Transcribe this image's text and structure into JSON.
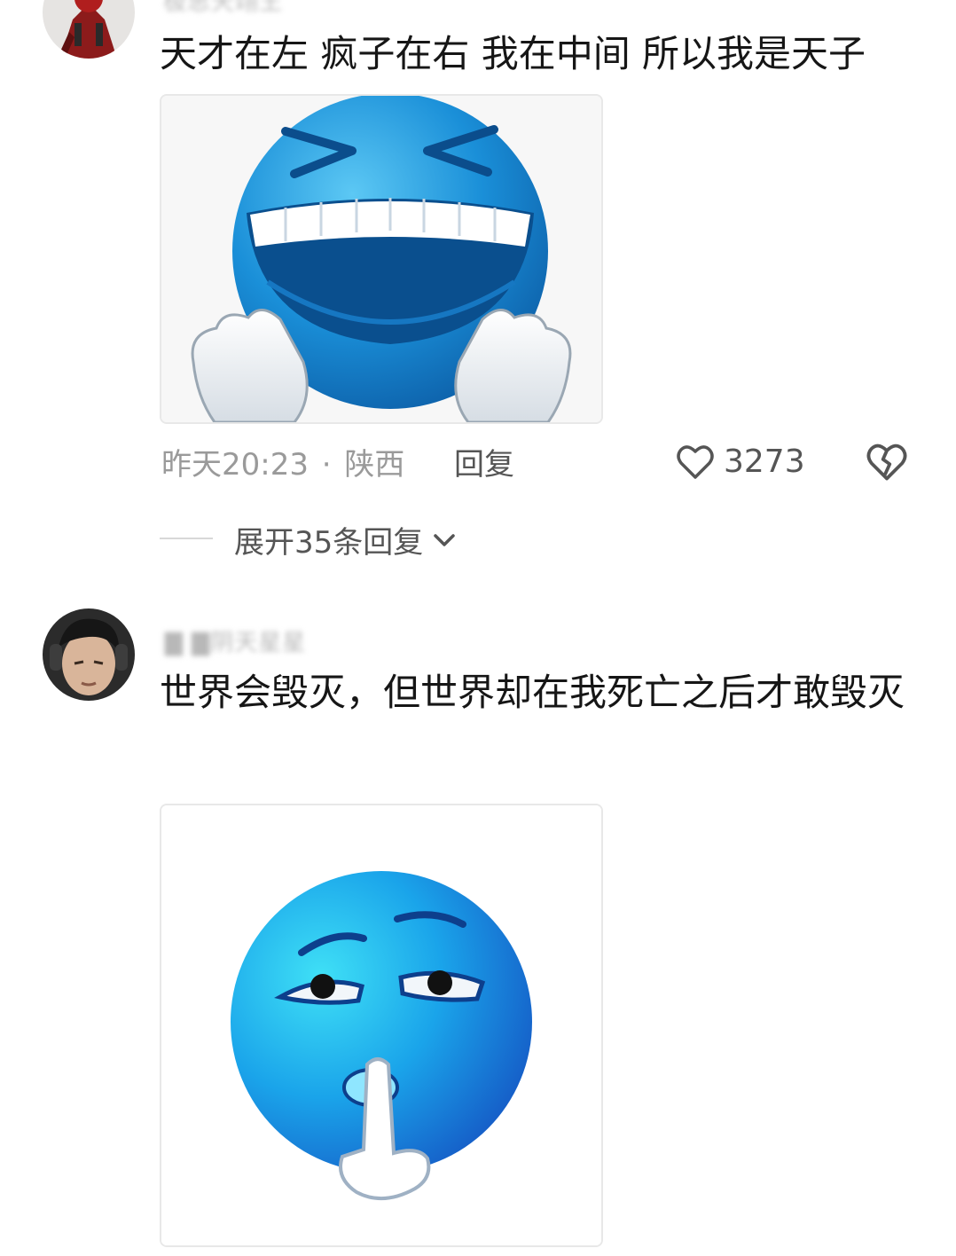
{
  "comments": [
    {
      "username": "极思天翊王",
      "text": "天才在左 疯子在右 我在中间 所以我是天子",
      "time": "昨天20:23",
      "location": "陕西",
      "separator": "·",
      "reply_label": "回复",
      "likes": "3273",
      "media": "laughing-blue-emoji"
    },
    {
      "username": "▇ ▇阴天星星",
      "text": "世界会毁灭，但世界却在我死亡之后才敢毁灭",
      "media": "shushing-blue-emoji"
    }
  ],
  "expand_replies": {
    "label": "展开35条回复"
  },
  "colors": {
    "meta": "#9a9a9a",
    "text": "#161616",
    "emoji_blue": "#1e9be0"
  }
}
